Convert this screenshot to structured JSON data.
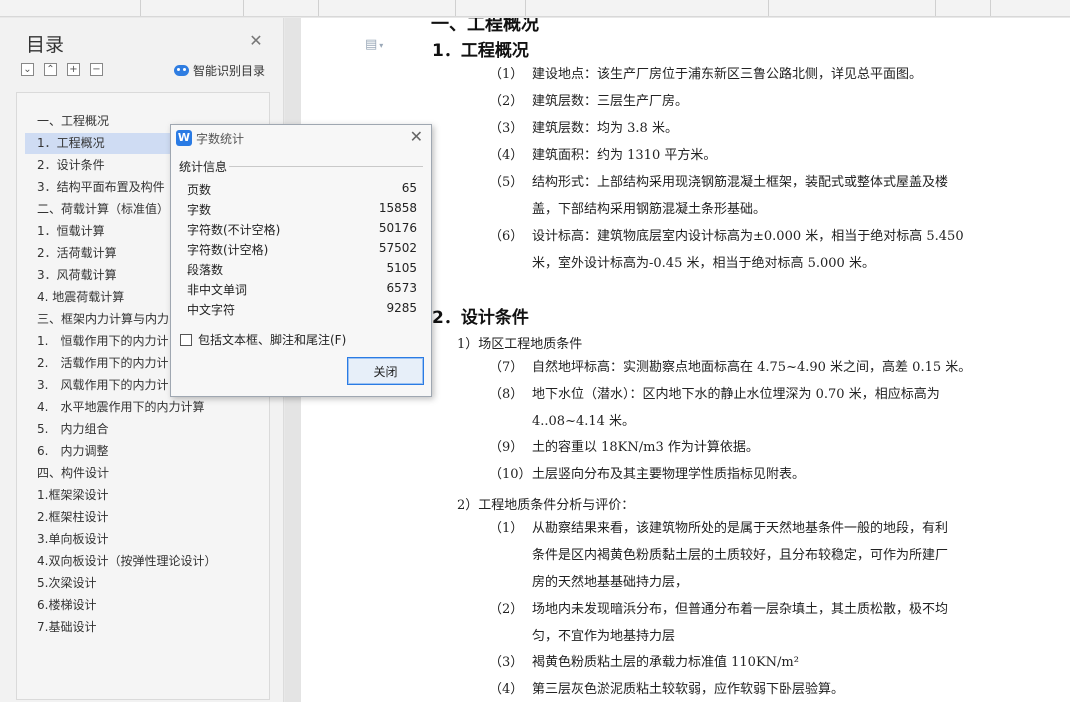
{
  "sidebar": {
    "title": "目录",
    "smart_toc_label": "智能识别目录",
    "tools": [
      "⌄",
      "⌃",
      "+",
      "−"
    ],
    "items": [
      {
        "label": "一、工程概况",
        "level": 1
      },
      {
        "label": "1．工程概况",
        "level": 1,
        "selected": true
      },
      {
        "label": "2．设计条件",
        "level": 1
      },
      {
        "label": "3．结构平面布置及构件",
        "level": 1
      },
      {
        "label": "二、荷载计算（标准值）",
        "level": 1
      },
      {
        "label": "1．恒载计算",
        "level": 1
      },
      {
        "label": "2．活荷载计算",
        "level": 1
      },
      {
        "label": "3．风荷载计算",
        "level": 1
      },
      {
        "label": "4. 地震荷载计算",
        "level": 1
      },
      {
        "label": "三、框架内力计算与内力",
        "level": 1
      },
      {
        "label": "1.　恒载作用下的内力计",
        "level": 1
      },
      {
        "label": "2.　活载作用下的内力计",
        "level": 1
      },
      {
        "label": "3.　风载作用下的内力计",
        "level": 1
      },
      {
        "label": "4.　水平地震作用下的内力计算",
        "level": 1
      },
      {
        "label": "5.　内力组合",
        "level": 1
      },
      {
        "label": "6.　内力调整",
        "level": 1
      },
      {
        "label": "四、构件设计",
        "level": 1
      },
      {
        "label": "1.框架梁设计",
        "level": 1
      },
      {
        "label": "2.框架柱设计",
        "level": 1
      },
      {
        "label": "3.单向板设计",
        "level": 1
      },
      {
        "label": "4.双向板设计（按弹性理论设计）",
        "level": 1
      },
      {
        "label": "5.次梁设计",
        "level": 1
      },
      {
        "label": "6.楼梯设计",
        "level": 1
      },
      {
        "label": "7.基础设计",
        "level": 1
      }
    ]
  },
  "dialog": {
    "title": "字数统计",
    "logo": "W",
    "group_label": "统计信息",
    "stats": [
      {
        "label": "页数",
        "value": "65"
      },
      {
        "label": "字数",
        "value": "15858"
      },
      {
        "label": "字符数(不计空格)",
        "value": "50176"
      },
      {
        "label": "字符数(计空格)",
        "value": "57502"
      },
      {
        "label": "段落数",
        "value": "5105"
      },
      {
        "label": "非中文单词",
        "value": "6573"
      },
      {
        "label": "中文字符",
        "value": "9285"
      }
    ],
    "checkbox_label": "包括文本框、脚注和尾注(F)",
    "close_button": "关闭"
  },
  "document": {
    "cut_heading": "一、工程概况",
    "heading1": "1．工程概况",
    "items1": [
      {
        "num": "（1）",
        "lines": [
          "建设地点：该生产厂房位于浦东新区三鲁公路北侧，详见总平面图。"
        ]
      },
      {
        "num": "（2）",
        "lines": [
          "建筑层数：三层生产厂房。"
        ]
      },
      {
        "num": "（3）",
        "lines": [
          "建筑层数：均为 3.8 米。"
        ]
      },
      {
        "num": "（4）",
        "lines": [
          "建筑面积：约为 1310 平方米。"
        ]
      },
      {
        "num": "（5）",
        "lines": [
          "结构形式：上部结构采用现浇钢筋混凝土框架，装配式或整体式屋盖及楼",
          "盖，下部结构采用钢筋混凝土条形基础。"
        ]
      },
      {
        "num": "（6）",
        "lines": [
          "设计标高：建筑物底层室内设计标高为±0.000 米，相当于绝对标高 5.450",
          "米，室外设计标高为-0.45 米，相当于绝对标高 5.000 米。"
        ]
      }
    ],
    "heading2": "2．设计条件",
    "sub1": "1）场区工程地质条件",
    "items2": [
      {
        "num": "（7）",
        "lines": [
          "自然地坪标高：实测勘察点地面标高在 4.75~4.90 米之间，高差 0.15 米。"
        ]
      },
      {
        "num": "（8）",
        "lines": [
          "地下水位（潜水）：区内地下水的静止水位埋深为 0.70 米，相应标高为",
          "4..08~4.14 米。"
        ]
      },
      {
        "num": "（9）",
        "lines": [
          "土的容重以 18KN/m3 作为计算依据。"
        ]
      },
      {
        "num": "（10）",
        "lines": [
          "土层竖向分布及其主要物理学性质指标见附表。"
        ]
      }
    ],
    "sub2": "2）工程地质条件分析与评价：",
    "items3": [
      {
        "num": "（1）",
        "lines": [
          "从勘察结果来看，该建筑物所处的是属于天然地基条件一般的地段，有利",
          "条件是区内褐黄色粉质黏土层的土质较好，且分布较稳定，可作为所建厂",
          "房的天然地基基础持力层，"
        ]
      },
      {
        "num": "（2）",
        "lines": [
          "场地内未发现暗浜分布，但普通分布着一层杂填土，其土质松散，极不均",
          "匀，不宜作为地基持力层"
        ]
      },
      {
        "num": "（3）",
        "lines": [
          "褐黄色粉质粘土层的承载力标准值 110KN/m²"
        ]
      },
      {
        "num": "（4）",
        "lines": [
          "第三层灰色淤泥质粘土较软弱，应作软弱下卧层验算。"
        ]
      }
    ]
  }
}
